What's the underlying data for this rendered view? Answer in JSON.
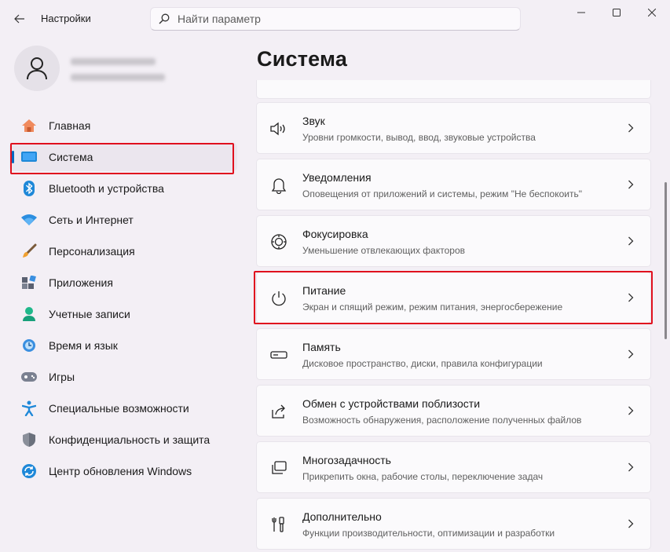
{
  "window": {
    "title": "Настройки",
    "controls": [
      "minimize",
      "maximize",
      "close"
    ]
  },
  "search": {
    "placeholder": "Найти параметр"
  },
  "sidebar": {
    "items": [
      {
        "label": "Главная",
        "icon": "home-icon"
      },
      {
        "label": "Система",
        "icon": "system-icon",
        "active": true
      },
      {
        "label": "Bluetooth и устройства",
        "icon": "bluetooth-icon"
      },
      {
        "label": "Сеть и Интернет",
        "icon": "wifi-icon"
      },
      {
        "label": "Персонализация",
        "icon": "brush-icon"
      },
      {
        "label": "Приложения",
        "icon": "apps-icon"
      },
      {
        "label": "Учетные записи",
        "icon": "account-icon"
      },
      {
        "label": "Время и язык",
        "icon": "time-language-icon"
      },
      {
        "label": "Игры",
        "icon": "gamepad-icon"
      },
      {
        "label": "Специальные возможности",
        "icon": "accessibility-icon"
      },
      {
        "label": "Конфиденциальность и защита",
        "icon": "shield-icon"
      },
      {
        "label": "Центр обновления Windows",
        "icon": "update-icon"
      }
    ]
  },
  "main": {
    "title": "Система",
    "cards": [
      {
        "title": "Звук",
        "desc": "Уровни громкости, вывод, ввод, звуковые устройства",
        "icon": "speaker-icon"
      },
      {
        "title": "Уведомления",
        "desc": "Оповещения от приложений и системы, режим \"Не беспокоить\"",
        "icon": "bell-icon"
      },
      {
        "title": "Фокусировка",
        "desc": "Уменьшение отвлекающих факторов",
        "icon": "focus-icon"
      },
      {
        "title": "Питание",
        "desc": "Экран и спящий режим, режим питания, энергосбережение",
        "icon": "power-icon"
      },
      {
        "title": "Память",
        "desc": "Дисковое пространство, диски, правила конфигурации",
        "icon": "storage-icon"
      },
      {
        "title": "Обмен с устройствами поблизости",
        "desc": "Возможность обнаружения, расположение полученных файлов",
        "icon": "share-icon"
      },
      {
        "title": "Многозадачность",
        "desc": "Прикрепить окна, рабочие столы, переключение задач",
        "icon": "multitasking-icon"
      },
      {
        "title": "Дополнительно",
        "desc": "Функции производительности, оптимизации и разработки",
        "icon": "tools-icon"
      }
    ]
  },
  "colors": {
    "accent": "#0067c0",
    "highlight": "#e0101e",
    "background": "#f3eff5",
    "card": "#fbfafc"
  }
}
